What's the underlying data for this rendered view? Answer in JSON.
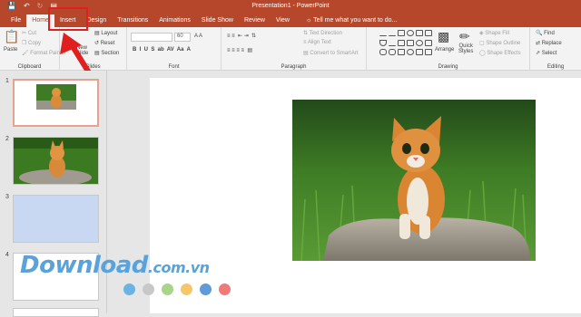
{
  "window": {
    "title": "Presentation1 - PowerPoint"
  },
  "tabs": [
    "File",
    "Home",
    "Insert",
    "Design",
    "Transitions",
    "Animations",
    "Slide Show",
    "Review",
    "View"
  ],
  "tellme": "Tell me what you want to do...",
  "clipboard": {
    "paste": "Paste",
    "cut": "Cut",
    "copy": "Copy",
    "format_painter": "Format Painter",
    "label": "Clipboard"
  },
  "slides_group": {
    "new_slide_1": "New",
    "new_slide_2": "Slide",
    "layout": "Layout",
    "reset": "Reset",
    "section": "Section",
    "label": "Slides"
  },
  "font_group": {
    "size": "60",
    "label": "Font"
  },
  "paragraph_group": {
    "text_direction": "Text Direction",
    "align_text": "Align Text",
    "convert": "Convert to SmartArt",
    "label": "Paragraph"
  },
  "drawing_group": {
    "arrange": "Arrange",
    "quick_1": "Quick",
    "quick_2": "Styles",
    "fill": "Shape Fill",
    "outline": "Shape Outline",
    "effects": "Shape Effects",
    "label": "Drawing"
  },
  "editing_group": {
    "find": "Find",
    "replace": "Replace",
    "select": "Select",
    "label": "Editing"
  },
  "slide_numbers": [
    "1",
    "2",
    "3",
    "4"
  ],
  "watermark": {
    "main": "Download",
    "suffix": ".com.vn"
  },
  "colors": {
    "accent": "#b7472a",
    "highlight": "#e02020",
    "dots": [
      "#6ab3e3",
      "#c8c8c8",
      "#a9d58b",
      "#f7c66b",
      "#5f9bd6",
      "#ef7a7a"
    ]
  }
}
